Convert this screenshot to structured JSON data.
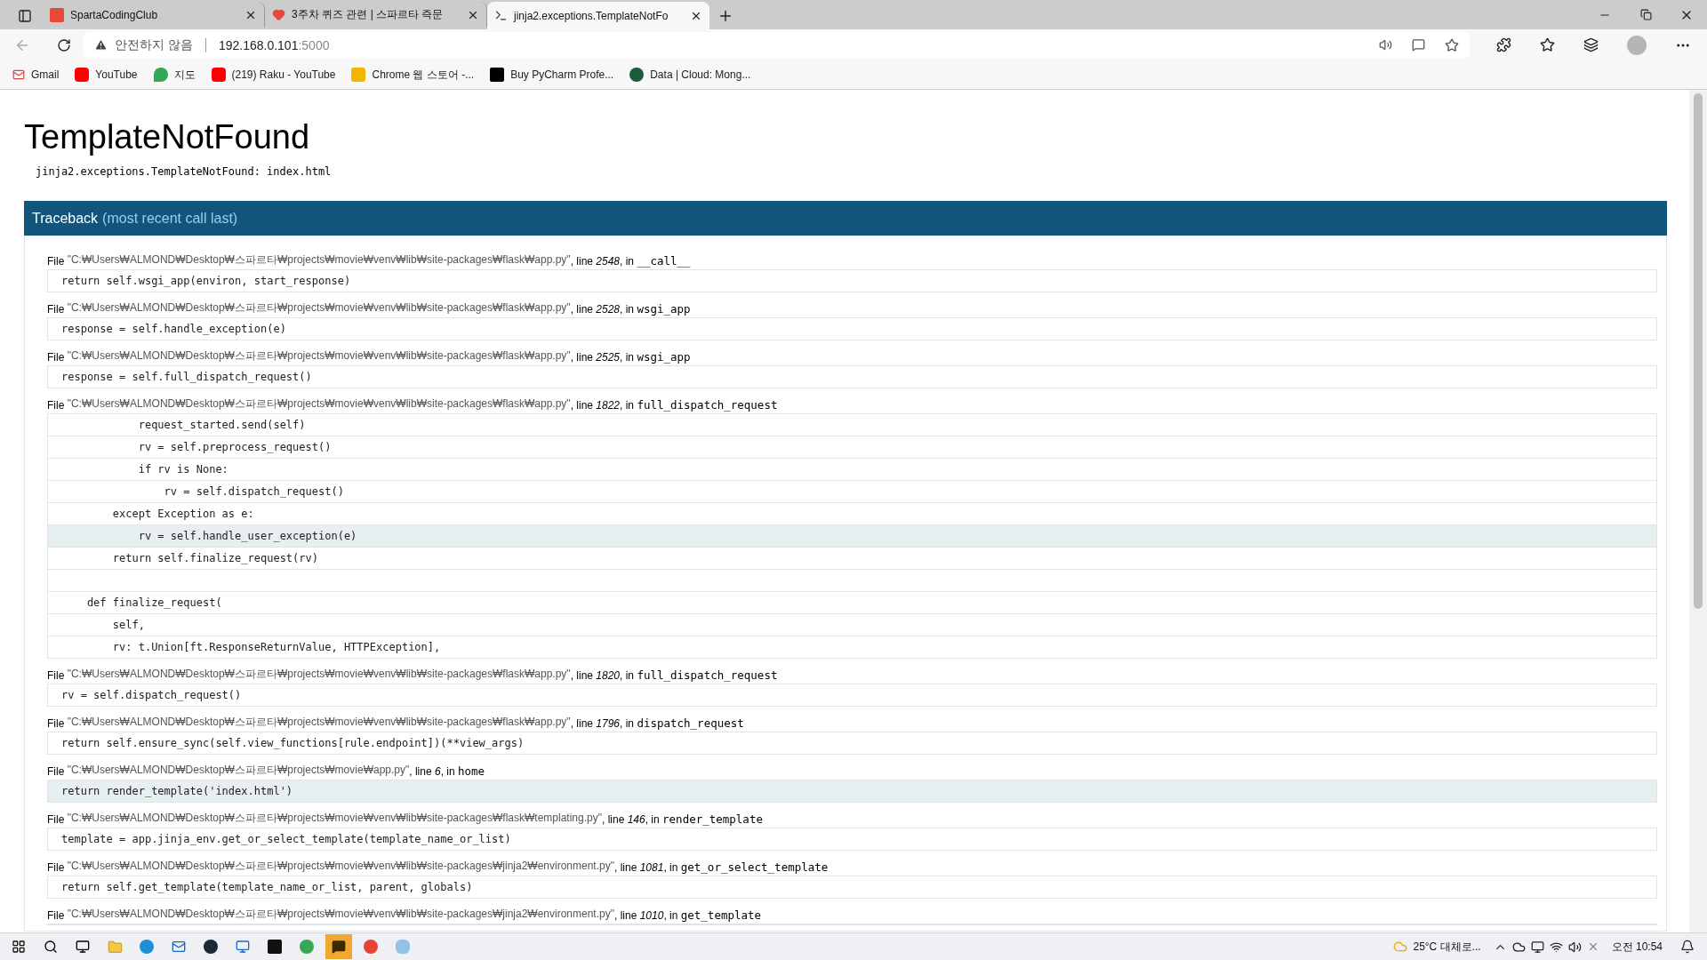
{
  "browser": {
    "tabs": [
      {
        "title": "SpartaCodingClub",
        "selected": false
      },
      {
        "title": "3주차 퀴즈 관련 | 스파르타 즉문",
        "selected": false
      },
      {
        "title": "jinja2.exceptions.TemplateNotFo",
        "selected": true
      }
    ],
    "address": {
      "security": "안전하지 않음",
      "host": "192.168.0.101",
      "port": ":5000"
    },
    "bookmarks": [
      "Gmail",
      "YouTube",
      "지도",
      "(219) Raku - YouTube",
      "Chrome 웹 스토어 -...",
      "Buy PyCharm Profe...",
      "Data | Cloud: Mong..."
    ]
  },
  "page": {
    "title": "TemplateNotFound",
    "message": "jinja2.exceptions.TemplateNotFound: index.html",
    "traceback_title": "Traceback",
    "traceback_note": "(most recent call last)",
    "frames": [
      {
        "file_word": "File",
        "path": "\"C:₩Users₩ALMOND₩Desktop₩스파르타₩projects₩movie₩venv₩lib₩site-packages₩flask₩app.py\"",
        "line_word": ", line",
        "line": "2548",
        "in_word": ", in",
        "function": "__call__",
        "lines": [
          {
            "kind": "code",
            "text": "return self.wsgi_app(environ, start_response)",
            "current": false
          }
        ]
      },
      {
        "file_word": "File",
        "path": "\"C:₩Users₩ALMOND₩Desktop₩스파르타₩projects₩movie₩venv₩lib₩site-packages₩flask₩app.py\"",
        "line_word": ", line",
        "line": "2528",
        "in_word": ", in",
        "function": "wsgi_app",
        "lines": [
          {
            "kind": "code",
            "text": "response = self.handle_exception(e)",
            "current": false
          }
        ]
      },
      {
        "file_word": "File",
        "path": "\"C:₩Users₩ALMOND₩Desktop₩스파르타₩projects₩movie₩venv₩lib₩site-packages₩flask₩app.py\"",
        "line_word": ", line",
        "line": "2525",
        "in_word": ", in",
        "function": "wsgi_app",
        "lines": [
          {
            "kind": "code",
            "text": "response = self.full_dispatch_request()",
            "current": false
          }
        ]
      },
      {
        "file_word": "File",
        "path": "\"C:₩Users₩ALMOND₩Desktop₩스파르타₩projects₩movie₩venv₩lib₩site-packages₩flask₩app.py\"",
        "line_word": ", line",
        "line": "1822",
        "in_word": ", in",
        "function": "full_dispatch_request",
        "lines": [
          {
            "kind": "code",
            "text": "            request_started.send(self)",
            "current": false
          },
          {
            "kind": "code",
            "text": "            rv = self.preprocess_request()",
            "current": false
          },
          {
            "kind": "code",
            "text": "            if rv is None:",
            "current": false
          },
          {
            "kind": "code",
            "text": "                rv = self.dispatch_request()",
            "current": false
          },
          {
            "kind": "code",
            "text": "        except Exception as e:",
            "current": false
          },
          {
            "kind": "code",
            "text": "            rv = self.handle_user_exception(e)",
            "current": true
          },
          {
            "kind": "code",
            "text": "        return self.finalize_request(rv)",
            "current": false
          },
          {
            "kind": "blank",
            "current": false
          },
          {
            "kind": "code",
            "text": "    def finalize_request(",
            "current": false
          },
          {
            "kind": "code",
            "text": "        self,",
            "current": false
          },
          {
            "kind": "code",
            "text": "        rv: t.Union[ft.ResponseReturnValue, HTTPException],",
            "current": false
          }
        ]
      },
      {
        "file_word": "File",
        "path": "\"C:₩Users₩ALMOND₩Desktop₩스파르타₩projects₩movie₩venv₩lib₩site-packages₩flask₩app.py\"",
        "line_word": ", line",
        "line": "1820",
        "in_word": ", in",
        "function": "full_dispatch_request",
        "lines": [
          {
            "kind": "code",
            "text": "rv = self.dispatch_request()",
            "current": false
          }
        ]
      },
      {
        "file_word": "File",
        "path": "\"C:₩Users₩ALMOND₩Desktop₩스파르타₩projects₩movie₩venv₩lib₩site-packages₩flask₩app.py\"",
        "line_word": ", line",
        "line": "1796",
        "in_word": ", in",
        "function": "dispatch_request",
        "lines": [
          {
            "kind": "code",
            "text": "return self.ensure_sync(self.view_functions[rule.endpoint])(**view_args)",
            "current": false
          }
        ]
      },
      {
        "file_word": "File",
        "path": "\"C:₩Users₩ALMOND₩Desktop₩스파르타₩projects₩movie₩app.py\"",
        "line_word": ", line",
        "line": "6",
        "in_word": ", in",
        "function": "home",
        "lines": [
          {
            "kind": "code",
            "text": "return render_template('index.html')",
            "current": true
          }
        ]
      },
      {
        "file_word": "File",
        "path": "\"C:₩Users₩ALMOND₩Desktop₩스파르타₩projects₩movie₩venv₩lib₩site-packages₩flask₩templating.py\"",
        "line_word": ", line",
        "line": "146",
        "in_word": ", in",
        "function": "render_template",
        "lines": [
          {
            "kind": "code",
            "text": "template = app.jinja_env.get_or_select_template(template_name_or_list)",
            "current": false
          }
        ]
      },
      {
        "file_word": "File",
        "path": "\"C:₩Users₩ALMOND₩Desktop₩스파르타₩projects₩movie₩venv₩lib₩site-packages₩jinja2₩environment.py\"",
        "line_word": ", line",
        "line": "1081",
        "in_word": ", in",
        "function": "get_or_select_template",
        "lines": [
          {
            "kind": "code",
            "text": "return self.get_template(template_name_or_list, parent, globals)",
            "current": false
          }
        ]
      },
      {
        "file_word": "File",
        "path": "\"C:₩Users₩ALMOND₩Desktop₩스파르타₩projects₩movie₩venv₩lib₩site-packages₩jinja2₩environment.py\"",
        "line_word": ", line",
        "line": "1010",
        "in_word": ", in",
        "function": "get_template"
      }
    ]
  },
  "taskbar": {
    "weather": "25°C 대체로...",
    "clock": "오전 10:54"
  }
}
